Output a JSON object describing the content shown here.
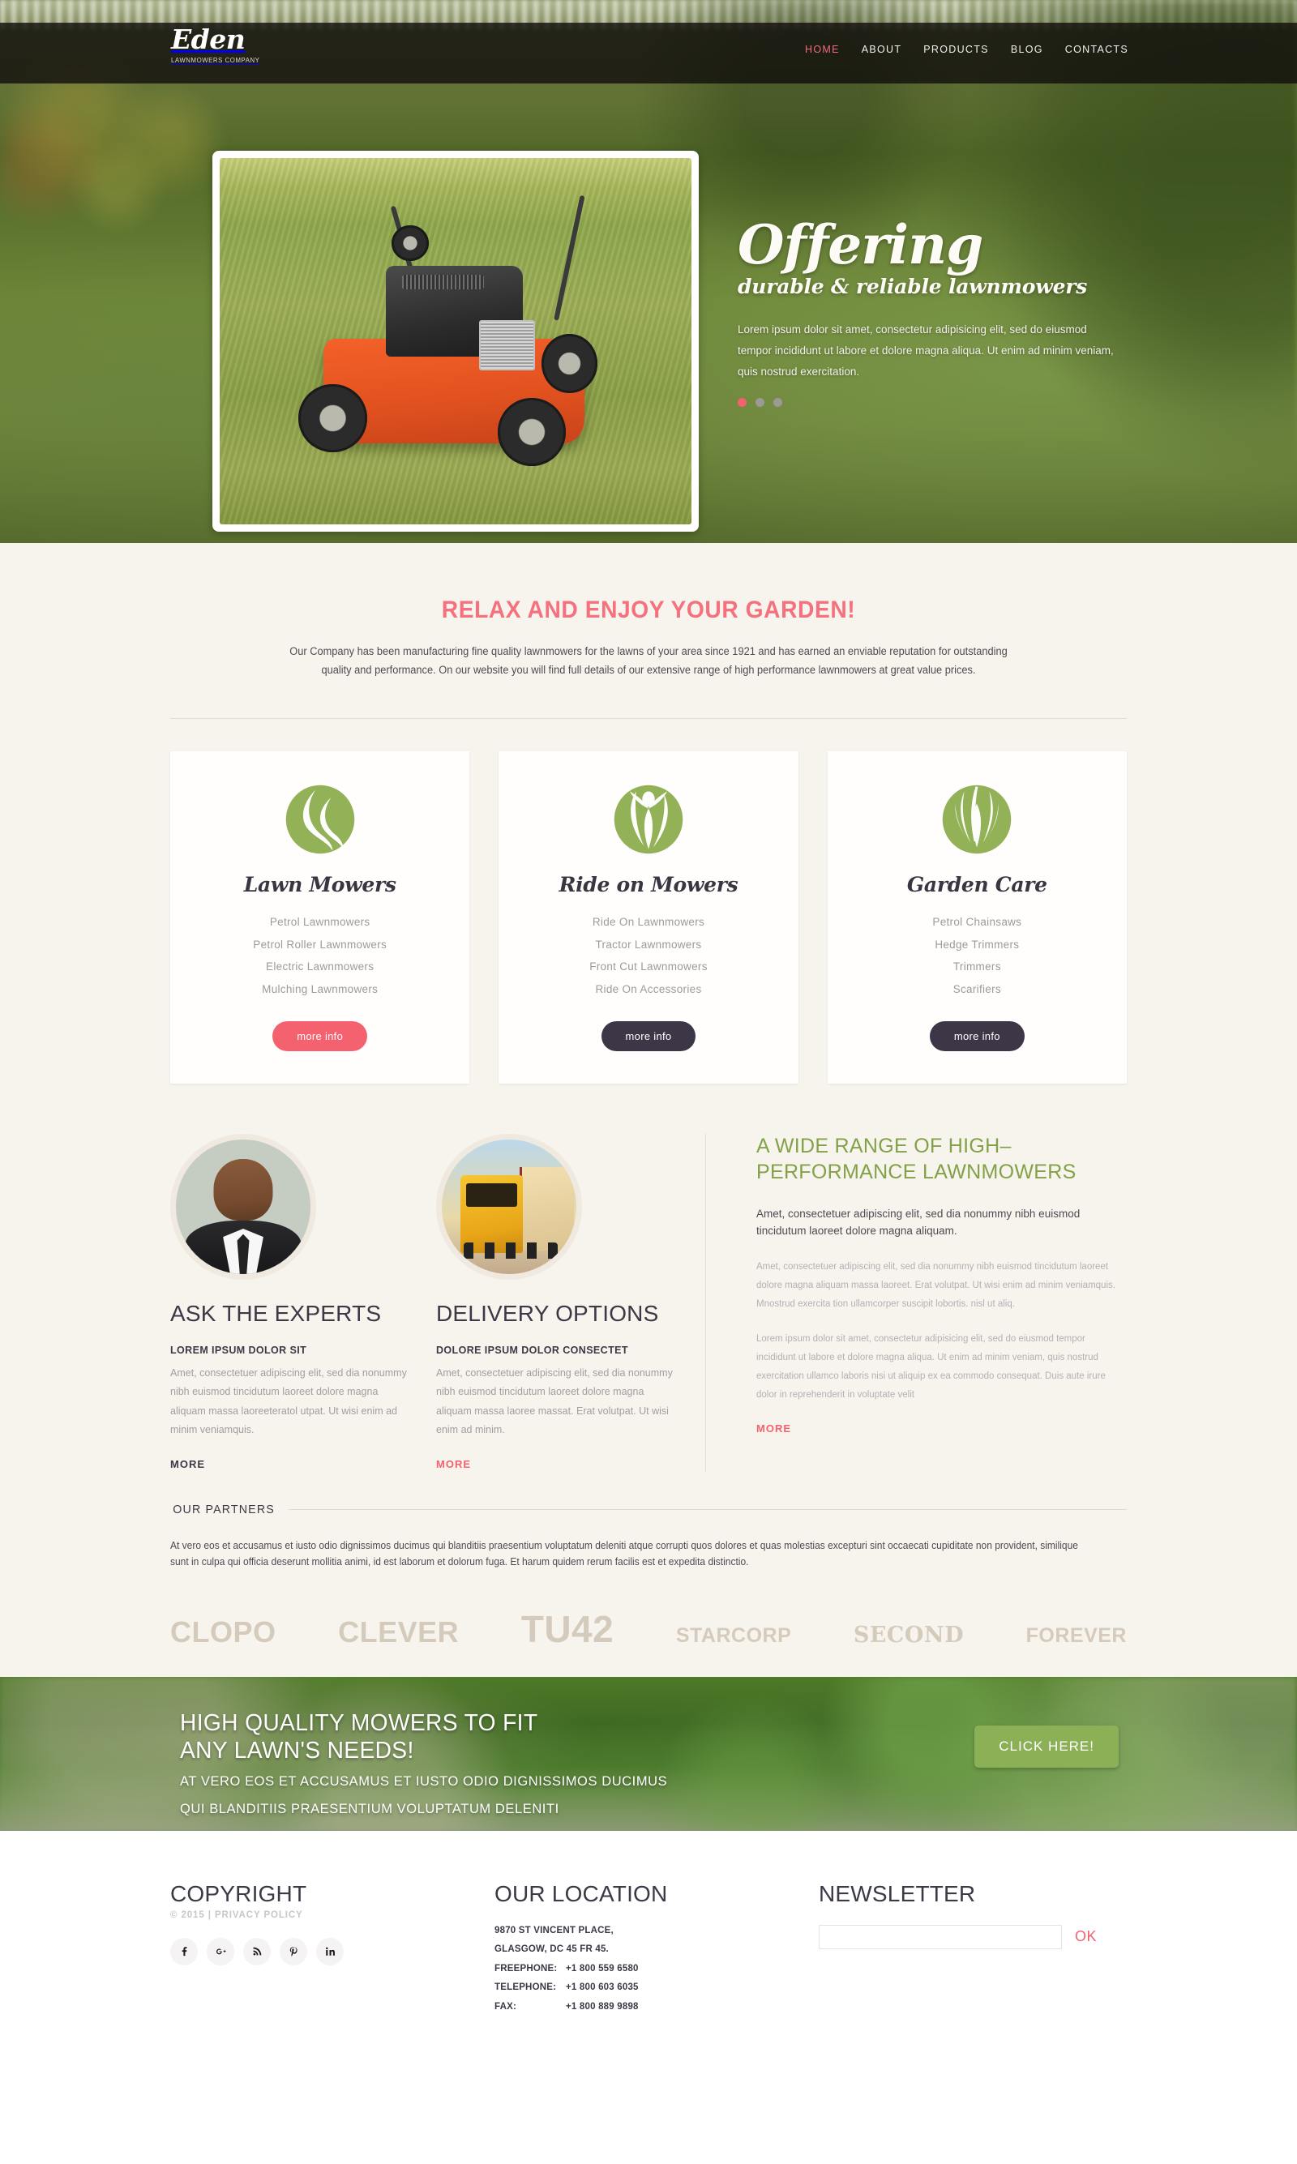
{
  "header": {
    "brand_name": "Eden",
    "brand_sub": "LAWNMOWERS COMPANY",
    "nav": [
      {
        "label": "HOME",
        "active": true
      },
      {
        "label": "ABOUT",
        "active": false
      },
      {
        "label": "PRODUCTS",
        "active": false
      },
      {
        "label": "BLOG",
        "active": false
      },
      {
        "label": "CONTACTS",
        "active": false
      }
    ]
  },
  "hero": {
    "title": "Offering",
    "subtitle": "durable & reliable lawnmowers",
    "paragraph": "Lorem ipsum dolor sit amet, consectetur adipisicing elit, sed do eiusmod tempor incididunt ut labore et dolore magna aliqua. Ut enim ad minim veniam, quis nostrud exercitation.",
    "slide_count": 3,
    "active_slide": 1,
    "image_alt": "orange petrol lawnmower on cut grass"
  },
  "intro": {
    "title": "RELAX AND ENJOY YOUR GARDEN!",
    "paragraph": "Our Company has been manufacturing fine quality lawnmowers for the lawns of your area since 1921 and has earned an enviable reputation for outstanding quality and performance. On our website you will find full details of our extensive range of high performance lawnmowers at great value prices."
  },
  "cards": [
    {
      "icon": "leaf-swirl-circle-icon",
      "title": "Lawn Mowers",
      "items": [
        "Petrol Lawnmowers",
        "Petrol Roller Lawnmowers",
        "Electric Lawnmowers",
        "Mulching Lawnmowers"
      ],
      "button": "more info",
      "button_style": "pink"
    },
    {
      "icon": "plant-figure-circle-icon",
      "title": "Ride on Mowers",
      "items": [
        "Ride On Lawnmowers",
        "Tractor Lawnmowers",
        "Front Cut Lawnmowers",
        "Ride On Accessories"
      ],
      "button": "more info",
      "button_style": "dark"
    },
    {
      "icon": "grass-blades-circle-icon",
      "title": "Garden Care",
      "items": [
        "Petrol Chainsaws",
        "Hedge Trimmers",
        "Trimmers",
        "Scarifiers"
      ],
      "button": "more info",
      "button_style": "dark"
    }
  ],
  "features": {
    "experts": {
      "avatar": "businessman-portrait",
      "title": "ASK THE EXPERTS",
      "subhead": "LOREM IPSUM DOLOR SIT",
      "body": "Amet, consectetuer adipiscing elit, sed dia nonummy nibh euismod tincidutum laoreet dolore magna aliquam massa laoreeteratol utpat. Ut wisi enim ad minim veniamquis.",
      "link": "MORE"
    },
    "delivery": {
      "avatar": "yellow-truck-photo",
      "title": "DELIVERY OPTIONS",
      "subhead": "DOLORE IPSUM DOLOR CONSECTET",
      "body": "Amet, consectetuer adipiscing elit, sed dia nonummy nibh euismod tincidutum laoreet dolore magna aliquam massa laoree massat. Erat volutpat. Ut wisi enim ad minim.",
      "link": "MORE"
    },
    "range": {
      "title": "A WIDE RANGE OF HIGH–PERFORMANCE LAWNMOWERS",
      "lead": "Amet, consectetuer adipiscing elit, sed dia nonummy nibh euismod tincidutum laoreet dolore magna aliquam.",
      "body1": "Amet, consectetuer adipiscing elit, sed dia nonummy nibh euismod tincidutum laoreet dolore magna aliquam massa laoreet. Erat volutpat. Ut wisi enim ad minim veniamquis. Mnostrud exercita tion ullamcorper suscipit lobortis. nisl ut aliq.",
      "body2": "Lorem ipsum dolor sit amet, consectetur adipisicing elit, sed do eiusmod tempor incididunt ut labore et dolore magna aliqua. Ut enim ad minim veniam, quis nostrud exercitation ullamco laboris nisi ut aliquip ex ea commodo consequat. Duis aute irure dolor in reprehenderit in voluptate velit",
      "link": "MORE"
    }
  },
  "partners": {
    "heading": "OUR PARTNERS",
    "paragraph": "At vero eos et accusamus et iusto odio dignissimos ducimus qui blanditiis praesentium voluptatum deleniti atque corrupti quos dolores et quas molestias excepturi sint occaecati cupiditate non provident, similique sunt in culpa qui officia deserunt mollitia animi, id est laborum et dolorum fuga. Et harum quidem rerum facilis est et expedita distinctio.",
    "logos": [
      "CLOPO",
      "CLEVER",
      "TU42",
      "STARCORP",
      "SECOND",
      "FOREVER"
    ]
  },
  "cta": {
    "heading_line1": "HIGH QUALITY MOWERS TO FIT",
    "heading_line2": "ANY LAWN'S NEEDS!",
    "sub_line1": "AT VERO EOS ET ACCUSAMUS ET IUSTO ODIO DIGNISSIMOS DUCIMUS",
    "sub_line2": "QUI BLANDITIIS PRAESENTIUM VOLUPTATUM DELENITI",
    "button": "CLICK HERE!"
  },
  "footer": {
    "copyright": {
      "title": "COPYRIGHT",
      "line": "© 2015 | PRIVACY POLICY",
      "socials": [
        "facebook-icon",
        "google-plus-icon",
        "rss-icon",
        "pinterest-icon",
        "linkedin-icon"
      ]
    },
    "location": {
      "title": "OUR LOCATION",
      "address_line1": "9870 ST VINCENT PLACE,",
      "address_line2": "GLASGOW, DC 45 FR 45.",
      "freephone_label": "FREEPHONE:",
      "freephone_value": "+1 800 559 6580",
      "telephone_label": "TELEPHONE:",
      "telephone_value": "+1 800 603 6035",
      "fax_label": "FAX:",
      "fax_value": "+1 800 889 9898"
    },
    "newsletter": {
      "title": "NEWSLETTER",
      "input_value": "",
      "input_placeholder": "",
      "submit": "OK"
    }
  },
  "colors": {
    "accent_pink": "#f4626f",
    "accent_green": "#82a149",
    "dark": "#3d3746",
    "page_bg": "#f7f4ee",
    "cta_button": "#8cb055"
  }
}
